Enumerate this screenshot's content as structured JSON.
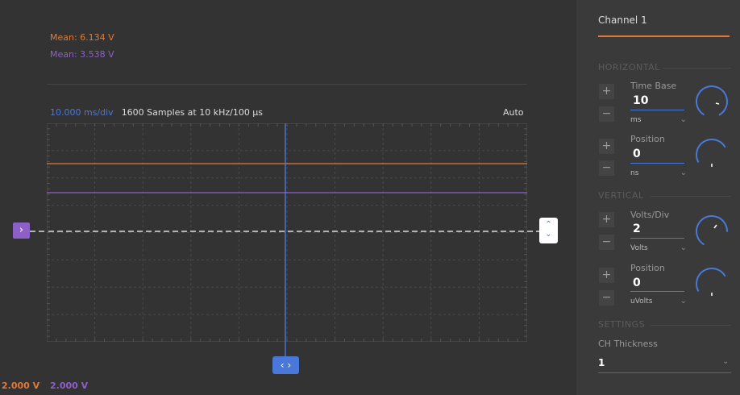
{
  "measurements": {
    "mean_orange": "Mean: 6.134 V",
    "mean_purple": "Mean: 3.538 V"
  },
  "plot_header": {
    "rate": "10.000 ms/div",
    "samples": "1600 Samples at 10 kHz/100 µs",
    "trigger_mode": "Auto"
  },
  "handles": {
    "left_icon": "chevron-right-icon",
    "left_glyph": "›",
    "right_icon": "chevron-up-down-icon",
    "right_up": "⌃",
    "right_down": "⌄",
    "bottom_icon": "chevron-left-right-icon",
    "bottom_glyph": "‹ ›"
  },
  "scale_labels": {
    "ch1": "2.000 V",
    "ch2": "2.000 V"
  },
  "colors": {
    "channel1": "#e07a3a",
    "channel2": "#8e5fc7",
    "time_cursor": "#4a78d8",
    "trigger_level": "#ffffff"
  },
  "panel": {
    "channel_title": "Channel 1",
    "horizontal": {
      "heading": "HORIZONTAL",
      "time_base": {
        "label": "Time Base",
        "value": "10",
        "unit": "ms"
      },
      "position": {
        "label": "Position",
        "value": "0",
        "unit": "ns"
      }
    },
    "vertical": {
      "heading": "VERTICAL",
      "volts_div": {
        "label": "Volts/Div",
        "value": "2",
        "unit": "Volts"
      },
      "position": {
        "label": "Position",
        "value": "0",
        "unit": "uVolts"
      }
    },
    "settings": {
      "heading": "SETTINGS",
      "thickness_label": "CH Thickness",
      "thickness_value": "1"
    },
    "plus": "+",
    "minus": "−",
    "chevron": "⌄"
  }
}
